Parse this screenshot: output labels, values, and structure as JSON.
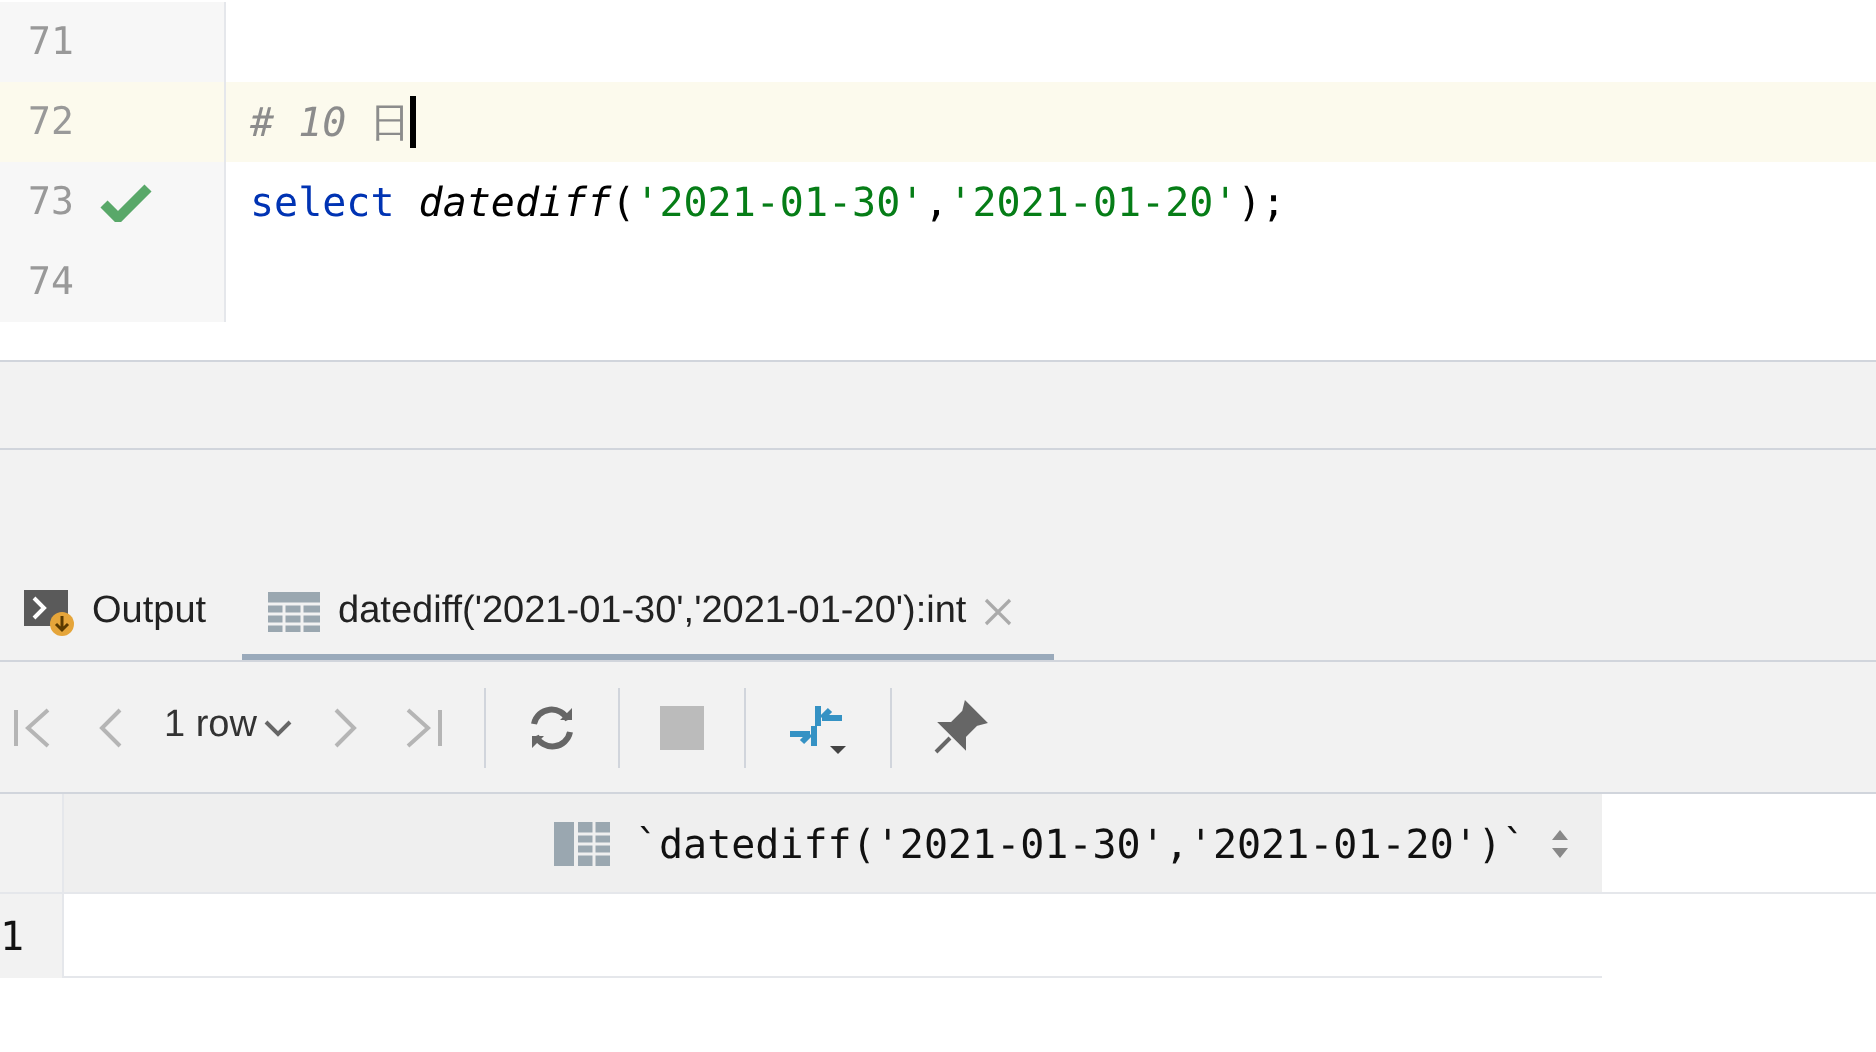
{
  "editor": {
    "lines": [
      {
        "number": "71",
        "current": false,
        "ok": false
      },
      {
        "number": "72",
        "current": true,
        "ok": false,
        "tokens": [
          {
            "kind": "comment",
            "text": "# 10 "
          },
          {
            "kind": "cjk",
            "text": "日"
          }
        ]
      },
      {
        "number": "73",
        "current": false,
        "ok": true,
        "tokens": [
          {
            "kind": "keyword",
            "text": "select "
          },
          {
            "kind": "function",
            "text": "datediff"
          },
          {
            "kind": "punct",
            "text": "("
          },
          {
            "kind": "string",
            "text": "'2021-01-30'"
          },
          {
            "kind": "punct",
            "text": ","
          },
          {
            "kind": "string",
            "text": "'2021-01-20'"
          },
          {
            "kind": "punct",
            "text": ");"
          }
        ]
      },
      {
        "number": "74",
        "current": false,
        "ok": false
      }
    ]
  },
  "tabs": [
    {
      "label": "Output",
      "kind": "output",
      "selected": false,
      "closable": false
    },
    {
      "label": "datediff('2021-01-30','2021-01-20'):int",
      "kind": "table",
      "selected": true,
      "closable": true
    }
  ],
  "toolbar": {
    "row_count": "1 row"
  },
  "result": {
    "columns": [
      "`datediff('2021-01-30','2021-01-20')`"
    ],
    "rows": [
      {
        "number": "1",
        "cells": [
          ""
        ]
      }
    ]
  }
}
